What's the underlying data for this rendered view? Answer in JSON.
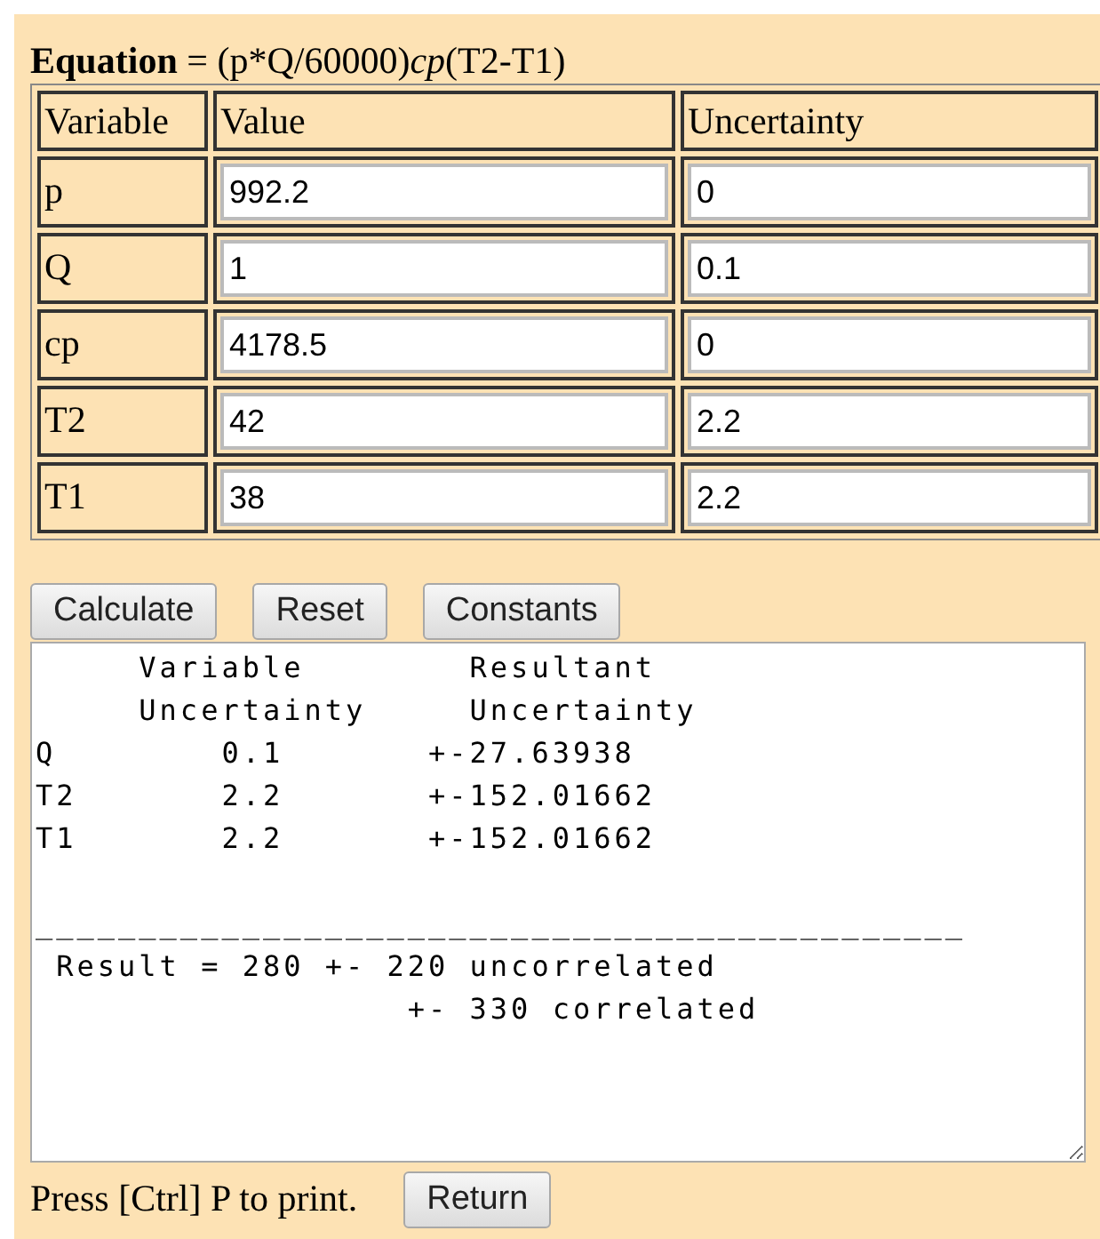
{
  "equation": "**Equation** = (p*Q/60000)*cp*(T2-T1)",
  "table": {
    "columns": [
      "Variable",
      "Value",
      "Uncertainty"
    ],
    "rows": [
      {
        "variable": "p",
        "value": "992.2",
        "uncertainty": "0"
      },
      {
        "variable": "Q",
        "value": "1",
        "uncertainty": "0.1"
      },
      {
        "variable": "cp",
        "value": "4178.5",
        "uncertainty": "0"
      },
      {
        "variable": "T2",
        "value": "42",
        "uncertainty": "2.2"
      },
      {
        "variable": "T1",
        "value": "38",
        "uncertainty": "2.2"
      }
    ]
  },
  "buttons": [
    "Calculate",
    "Reset",
    "Constants"
  ],
  "output": "     Variable        Resultant\n     Uncertainty     Uncertainty\nQ        0.1       +-27.63938\nT2       2.2       +-152.01662\nT1       2.2       +-152.01662\n\n_____________________________________________\n Result = 280 +- 220 uncorrelated\n                  +- 330 correlated",
  "footer": {
    "text": "Press [Ctrl] P to print.",
    "button": "Return"
  }
}
